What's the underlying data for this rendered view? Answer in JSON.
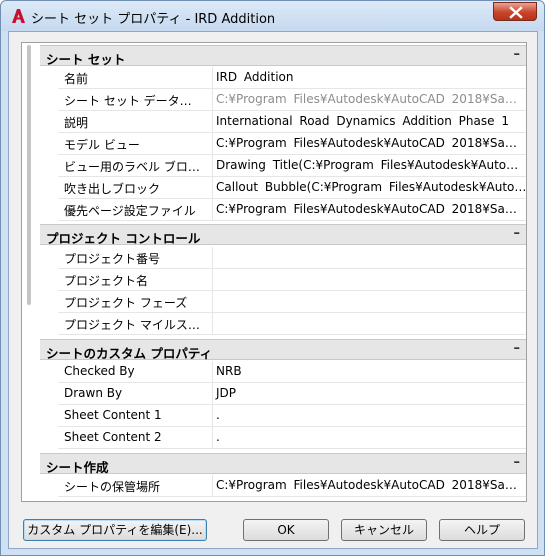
{
  "window": {
    "title": "シート セット プロパティ - IRD Addition"
  },
  "categories": [
    {
      "label": "シート セット",
      "toggle": "–",
      "rows": [
        {
          "name": "名前",
          "value": "IRD Addition",
          "greyed": false
        },
        {
          "name": "シート セット データ…",
          "value": "C:¥Program Files¥Autodesk¥AutoCAD 2018¥Sa…",
          "greyed": true
        },
        {
          "name": "説明",
          "value": "International Road Dynamics Addition Phase 1",
          "greyed": false
        },
        {
          "name": "モデル ビュー",
          "value": "C:¥Program Files¥Autodesk¥AutoCAD 2018¥Sa…",
          "greyed": false
        },
        {
          "name": "ビュー用のラベル ブロ…",
          "value": "Drawing Title(C:¥Program Files¥Autodesk¥Auto…",
          "greyed": false
        },
        {
          "name": "吹き出しブロック",
          "value": "Callout Bubble(C:¥Program Files¥Autodesk¥Auto…",
          "greyed": false
        },
        {
          "name": "優先ページ設定ファイル",
          "value": "C:¥Program Files¥Autodesk¥AutoCAD 2018¥Sa…",
          "greyed": false
        }
      ]
    },
    {
      "label": "プロジェクト コントロール",
      "toggle": "–",
      "rows": [
        {
          "name": "プロジェクト番号",
          "value": "",
          "greyed": false
        },
        {
          "name": "プロジェクト名",
          "value": "",
          "greyed": false
        },
        {
          "name": "プロジェクト フェーズ",
          "value": "",
          "greyed": false
        },
        {
          "name": "プロジェクト マイルス…",
          "value": "",
          "greyed": false
        }
      ]
    },
    {
      "label": "シートのカスタム プロパティ",
      "toggle": "–",
      "rows": [
        {
          "name": "Checked By",
          "value": "NRB",
          "greyed": false
        },
        {
          "name": "Drawn By",
          "value": "JDP",
          "greyed": false
        },
        {
          "name": "Sheet Content 1",
          "value": ".",
          "greyed": false
        },
        {
          "name": "Sheet Content 2",
          "value": ".",
          "greyed": false
        }
      ]
    },
    {
      "label": "シート作成",
      "toggle": "–",
      "rows": [
        {
          "name": "シートの保管場所",
          "value": "C:¥Program Files¥Autodesk¥AutoCAD 2018¥Sa…",
          "greyed": false
        }
      ]
    }
  ],
  "buttons": {
    "edit_custom": "カスタム プロパティを編集(E)...",
    "ok": "OK",
    "cancel": "キャンセル",
    "help": "ヘルプ"
  },
  "colors": {
    "accent": "#c8442b",
    "category_bg": "#e6e6e6",
    "greyed_text": "#8c8c8c"
  }
}
